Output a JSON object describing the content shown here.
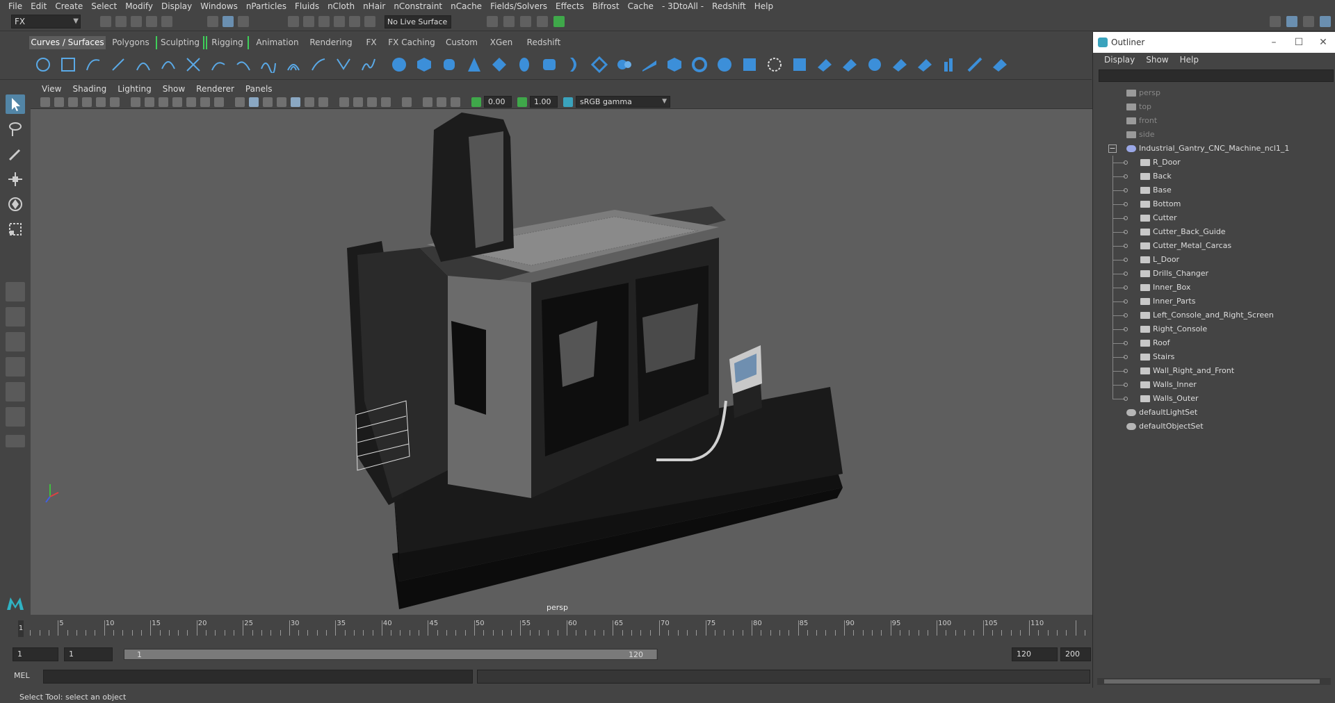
{
  "menubar": [
    "File",
    "Edit",
    "Create",
    "Select",
    "Modify",
    "Display",
    "Windows",
    "nParticles",
    "Fluids",
    "nCloth",
    "nHair",
    "nConstraint",
    "nCache",
    "Fields/Solvers",
    "Effects",
    "Bifrost",
    "Cache",
    "- 3DtoAll -",
    "Redshift",
    "Help"
  ],
  "statusline": {
    "mode": "FX",
    "live_surface": "No Live Surface"
  },
  "shelf_tabs": [
    "Curves / Surfaces",
    "Polygons",
    "Sculpting",
    "Rigging",
    "Animation",
    "Rendering",
    "FX",
    "FX Caching",
    "Custom",
    "XGen",
    "Redshift"
  ],
  "panel_menu": [
    "View",
    "Shading",
    "Lighting",
    "Show",
    "Renderer",
    "Panels"
  ],
  "panel_toolbar": {
    "near": "0.00",
    "far": "1.00",
    "color_space": "sRGB gamma"
  },
  "viewport": {
    "camera": "persp"
  },
  "timeline": {
    "ticks": [
      "5",
      "10",
      "15",
      "20",
      "25",
      "30",
      "35",
      "40",
      "45",
      "50",
      "55",
      "60",
      "65",
      "70",
      "75",
      "80",
      "85",
      "90",
      "95",
      "100",
      "105",
      "110"
    ],
    "current_frame": "1"
  },
  "range": {
    "start": "1",
    "playback_start": "1",
    "range_start_label": "1",
    "range_end_label": "120",
    "playback_end": "120",
    "end": "200"
  },
  "cmdline": {
    "language": "MEL"
  },
  "helpline": "Select Tool: select an object",
  "outliner": {
    "title": "Outliner",
    "menu": [
      "Display",
      "Show",
      "Help"
    ],
    "cameras": [
      "persp",
      "top",
      "front",
      "side"
    ],
    "root": "Industrial_Gantry_CNC_Machine_ncl1_1",
    "children": [
      "R_Door",
      "Back",
      "Base",
      "Bottom",
      "Cutter",
      "Cutter_Back_Guide",
      "Cutter_Metal_Carcas",
      "L_Door",
      "Drills_Changer",
      "Inner_Box",
      "Inner_Parts",
      "Left_Console_and_Right_Screen",
      "Right_Console",
      "Roof",
      "Stairs",
      "Wall_Right_and_Front",
      "Walls_Inner",
      "Walls_Outer"
    ],
    "sets": [
      "defaultLightSet",
      "defaultObjectSet"
    ]
  },
  "colors": {
    "accent": "#5285a6",
    "viewport_bg": "#5e5e5e",
    "panel_bg": "#444444"
  }
}
